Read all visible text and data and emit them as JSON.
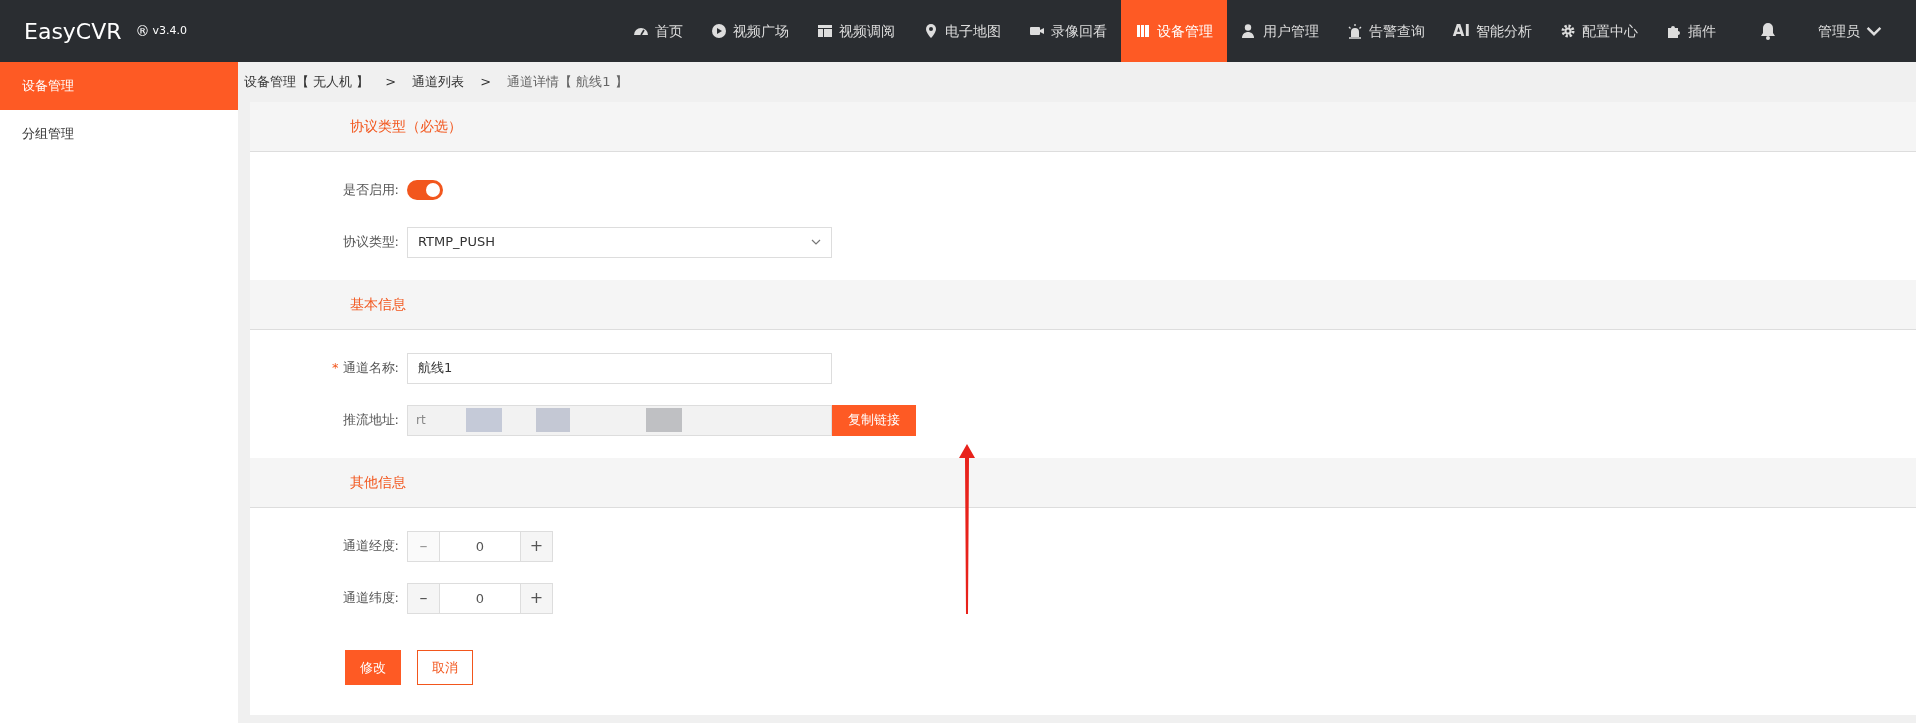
{
  "brand": {
    "name": "EasyCVR",
    "mark": "®",
    "version": "v3.4.0"
  },
  "nav": [
    {
      "label": "首页",
      "selected": false
    },
    {
      "label": "视频广场",
      "selected": false
    },
    {
      "label": "视频调阅",
      "selected": false
    },
    {
      "label": "电子地图",
      "selected": false
    },
    {
      "label": "录像回看",
      "selected": false
    },
    {
      "label": "设备管理",
      "selected": true
    },
    {
      "label": "用户管理",
      "selected": false
    },
    {
      "label": "告警查询",
      "selected": false
    },
    {
      "label": "智能分析",
      "prefix": "AI",
      "selected": false
    },
    {
      "label": "配置中心",
      "selected": false
    },
    {
      "label": "插件",
      "selected": false
    }
  ],
  "user": {
    "name": "管理员"
  },
  "sidebar": {
    "items": [
      {
        "label": "设备管理",
        "selected": true
      },
      {
        "label": "分组管理",
        "selected": false
      }
    ]
  },
  "breadcrumb": [
    "设备管理【 无人机 】",
    ">",
    "通道列表",
    ">",
    "通道详情【 航线1 】"
  ],
  "sections": [
    {
      "title": "协议类型（必选）",
      "fields": [
        {
          "kind": "switch",
          "label": "是否启用:",
          "on": true
        },
        {
          "kind": "select",
          "label": "协议类型:",
          "value": "RTMP_PUSH"
        }
      ]
    },
    {
      "title": "基本信息",
      "fields": [
        {
          "kind": "text",
          "label": "通道名称:",
          "required_mark": "*",
          "value": "航线1"
        },
        {
          "kind": "copy",
          "label": "推流地址:",
          "value": "rt",
          "redacted": true,
          "button": "复制链接"
        }
      ]
    },
    {
      "title": "其他信息",
      "fields": [
        {
          "kind": "stepper",
          "label": "通道经度:",
          "value": "0",
          "minus_disabled": true,
          "minus": "–",
          "plus": "+"
        },
        {
          "kind": "stepper",
          "label": "通道纬度:",
          "value": "0",
          "minus_disabled": false,
          "minus": "–",
          "plus": "+"
        }
      ]
    }
  ],
  "actions": [
    {
      "label": "修改",
      "kind": "primary"
    },
    {
      "label": "取消",
      "kind": "outline"
    }
  ]
}
